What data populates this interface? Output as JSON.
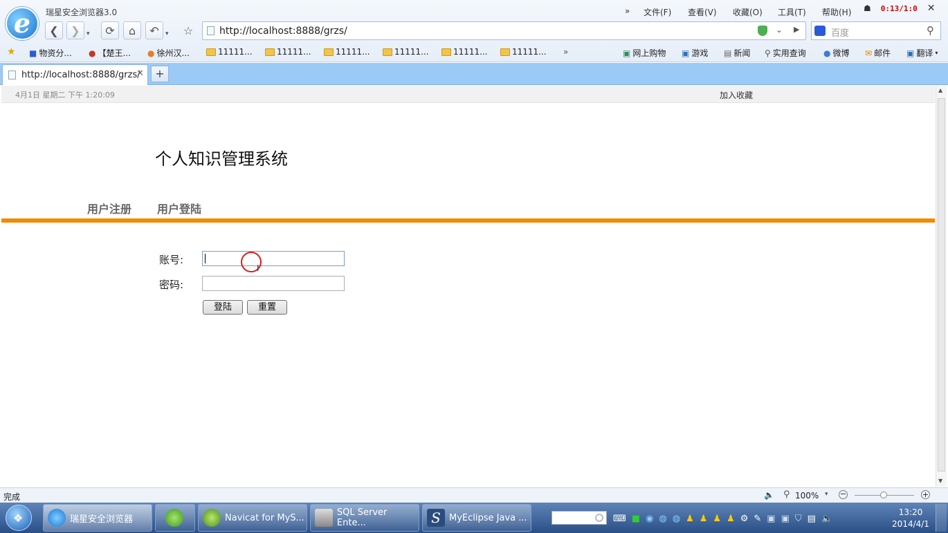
{
  "browser": {
    "title": "瑞星安全浏览器3.0",
    "menu": [
      "文件(F)",
      "查看(V)",
      "收藏(O)",
      "工具(T)",
      "帮助(H)"
    ],
    "menu_more": "»",
    "timer": "0:13/1:0",
    "address": "http://localhost:8888/grzs/",
    "search_placeholder": "百度",
    "bookmarks": [
      "物资分...",
      "【楚王...",
      "徐州汉...",
      "11111...",
      "11111...",
      "11111...",
      "11111...",
      "11111...",
      "11111..."
    ],
    "bookmarks_more": "»",
    "right_links": [
      "网上购物",
      "游戏",
      "新闻",
      "实用查询",
      "微博",
      "邮件",
      "翻译"
    ],
    "tab_label": "http://localhost:8888/grzs/",
    "tab_close": "✕",
    "new_tab": "+"
  },
  "page": {
    "datetime": "4月1日 星期二 下午  1:20:09",
    "add_favorite": "加入收藏",
    "site_title": "个人知识管理系统",
    "nav": [
      "用户注册",
      "用户登陆"
    ],
    "form": {
      "account_label": "账号:",
      "password_label": "密码:",
      "account_value": "",
      "password_value": "",
      "login_button": "登陆",
      "reset_button": "重置"
    }
  },
  "statusbar": {
    "status": "完成",
    "zoom": "100%"
  },
  "taskbar": {
    "tasks": [
      "瑞星安全浏览器",
      "",
      "Navicat for MyS...",
      "SQL Server Ente...",
      "MyEclipse Java ..."
    ],
    "time": "13:20",
    "date": "2014/4/1"
  }
}
